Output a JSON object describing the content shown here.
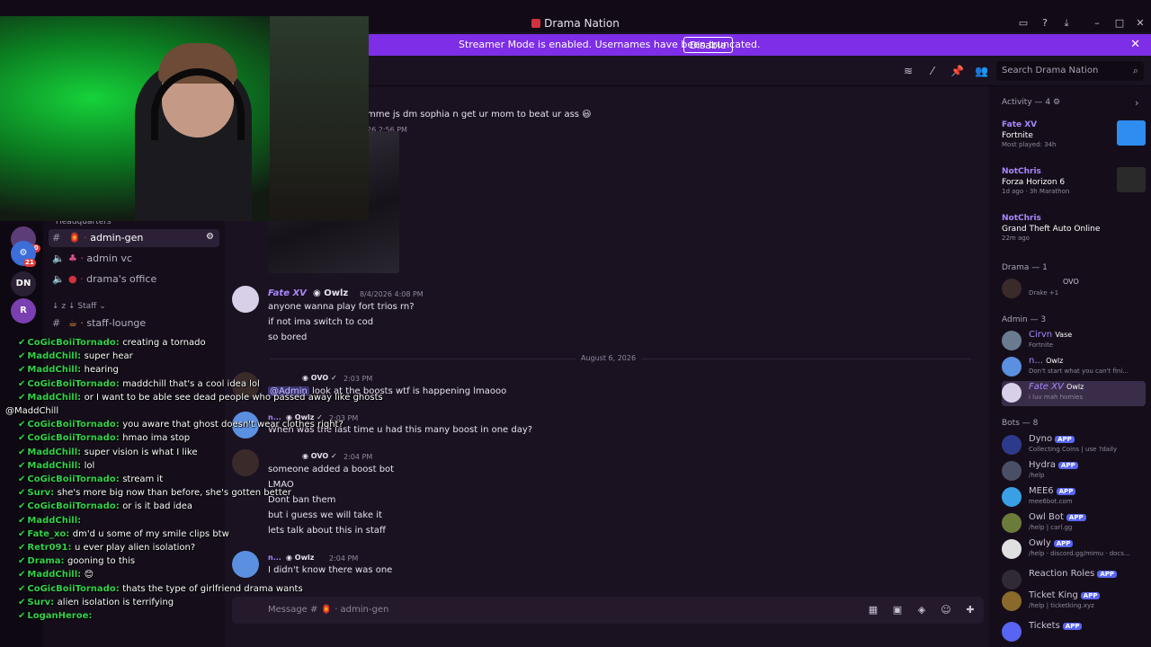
{
  "window": {
    "title": "Drama Nation"
  },
  "banner": {
    "text": "Streamer Mode is enabled. Usernames have been truncated.",
    "button": "Disable"
  },
  "search": {
    "placeholder": "Search Drama Nation"
  },
  "channels": {
    "category_top": "Headquarters",
    "items": [
      {
        "name": "admin-gen"
      },
      {
        "name": "admin vc"
      },
      {
        "name": "drama's office"
      }
    ],
    "category_staff": "Staff",
    "staff_items": [
      {
        "name": "staff-lounge"
      }
    ]
  },
  "servers": [
    {
      "label": "290",
      "color": "#5d3d77"
    },
    {
      "label": "21",
      "color": "#3c6dd8"
    },
    {
      "label": "DN",
      "color": "#2a1f33"
    },
    {
      "label": "R",
      "color": "#7a3fb0"
    }
  ],
  "messages": {
    "top_line": "mme js dm sophia n get ur mom to beat ur ass 😃",
    "top_time": "26 2:56 PM",
    "m1": {
      "author": "Fate XV",
      "tag": "Owlz",
      "time": "8/4/2026 4:08 PM",
      "lines": [
        "anyone wanna play fort trios rn?",
        "if not ima switch to cod",
        "so bored"
      ]
    },
    "date_divider": "August 6, 2026",
    "m2": {
      "tag": "OVO",
      "time": "2:03 PM",
      "mention": "@Admin",
      "text": "look at the boosts wtf is happening lmaooo"
    },
    "m3": {
      "author": "n...",
      "tag": "Owlz",
      "time": "2:03 PM",
      "text": "When was the last time u had this many boost in one day?"
    },
    "m4": {
      "tag": "OVO",
      "time": "2:04 PM",
      "lines": [
        "someone added a boost bot",
        "LMAO",
        "Dont ban them",
        "but i guess we will take it",
        "lets talk about this in staff"
      ]
    },
    "m5": {
      "author": "n...",
      "tag": "Owlz",
      "time": "2:04 PM",
      "text": "I didn't know there was one"
    }
  },
  "composer": {
    "placeholder": "Message # 🏮 · admin-gen"
  },
  "panel": {
    "activity_header": "Activity — 4",
    "activities": [
      {
        "name": "Fate XV",
        "game": "Fortnite",
        "sub": "Most played: 34h",
        "color": "#2f8df2"
      },
      {
        "name": "NotChris",
        "game": "Forza Horizon 6",
        "sub": "1d ago · 3h Marathon",
        "color": "#1a1a1a"
      },
      {
        "name": "NotChris",
        "game": "Grand Theft Auto Online",
        "sub": "22m ago",
        "color": "#1a1a1a"
      }
    ],
    "drama_header": "Drama — 1",
    "drama_member": {
      "name": "OVO",
      "sub": "Drake +1"
    },
    "admin_header": "Admin — 3",
    "admins": [
      {
        "name": "Cirvn",
        "tag": "Vase",
        "sub": "Fortnite"
      },
      {
        "name": "n...",
        "tag": "Owlz",
        "sub": "Don't start what you can't fini..."
      },
      {
        "name": "Fate XV",
        "tag": "Owlz",
        "sub": "i luv mah homies"
      }
    ],
    "bots_header": "Bots — 8",
    "bots": [
      {
        "name": "Dyno",
        "badge": "APP",
        "sub": "Collecting Coins | use ?daily",
        "color": "#2d3a8c"
      },
      {
        "name": "Hydra",
        "badge": "APP",
        "sub": "/help",
        "color": "#4a4f66"
      },
      {
        "name": "MEE6",
        "badge": "APP",
        "sub": "mee6bot.com",
        "color": "#3aa0e6"
      },
      {
        "name": "Owl Bot",
        "badge": "APP",
        "sub": "/help | carl.gg",
        "color": "#6b7b3a"
      },
      {
        "name": "Owly",
        "badge": "APP",
        "sub": "/help · discord.gg/mimu · docs...",
        "color": "#e0e0e0"
      },
      {
        "name": "Reaction Roles",
        "badge": "APP",
        "sub": "",
        "color": "#2f2a36"
      },
      {
        "name": "Ticket King",
        "badge": "APP",
        "sub": "/help | ticketking.xyz",
        "color": "#8a6a2a"
      },
      {
        "name": "Tickets",
        "badge": "APP",
        "sub": "",
        "color": "#5865f2"
      }
    ]
  },
  "chat_overlay": [
    {
      "user": "CoGicBoiiTornado",
      "text": "creating a tornado",
      "color": "#33d14a"
    },
    {
      "user": "MaddChill",
      "text": "super hear",
      "color": "#33d14a"
    },
    {
      "user": "MaddChill",
      "text": "hearing",
      "color": "#33d14a"
    },
    {
      "user": "CoGicBoiiTornado",
      "text": "maddchill that's a cool idea lol",
      "color": "#33d14a"
    },
    {
      "user": "MaddChill",
      "text": "or I want to be able see dead people who passed away like ghosts",
      "color": "#33d14a"
    },
    {
      "user": "",
      "text": "@MaddChill",
      "color": "#ffffff"
    },
    {
      "user": "CoGicBoiiTornado",
      "text": "you aware that ghost doesn't wear clothes right?",
      "color": "#33d14a"
    },
    {
      "user": "CoGicBoiiTornado",
      "text": "hmao ima stop",
      "color": "#33d14a"
    },
    {
      "user": "MaddChill",
      "text": "super vision is what I like",
      "color": "#33d14a"
    },
    {
      "user": "MaddChill",
      "text": "lol",
      "color": "#33d14a"
    },
    {
      "user": "CoGicBoiiTornado",
      "text": "stream it",
      "color": "#33d14a"
    },
    {
      "user": "Surv",
      "text": "she's more big now than before, she's gotten better",
      "color": "#33d14a"
    },
    {
      "user": "CoGicBoiiTornado",
      "text": "or is it bad idea",
      "color": "#33d14a"
    },
    {
      "user": "MaddChill",
      "text": "",
      "color": "#33d14a"
    },
    {
      "user": "Fate_xo",
      "text": "dm'd u some of my smile clips btw",
      "color": "#33d14a"
    },
    {
      "user": "Retr091",
      "text": "u ever play alien isolation?",
      "color": "#33d14a"
    },
    {
      "user": "Drama",
      "text": "gooning to this",
      "color": "#33d14a"
    },
    {
      "user": "MaddChill",
      "text": "😊",
      "color": "#33d14a"
    },
    {
      "user": "CoGicBoiiTornado",
      "text": "thats the type of girlfriend drama wants",
      "color": "#33d14a"
    },
    {
      "user": "Surv",
      "text": "alien isolation is terrifying",
      "color": "#33d14a"
    },
    {
      "user": "LoganHeroe",
      "text": "",
      "color": "#33d14a"
    }
  ]
}
